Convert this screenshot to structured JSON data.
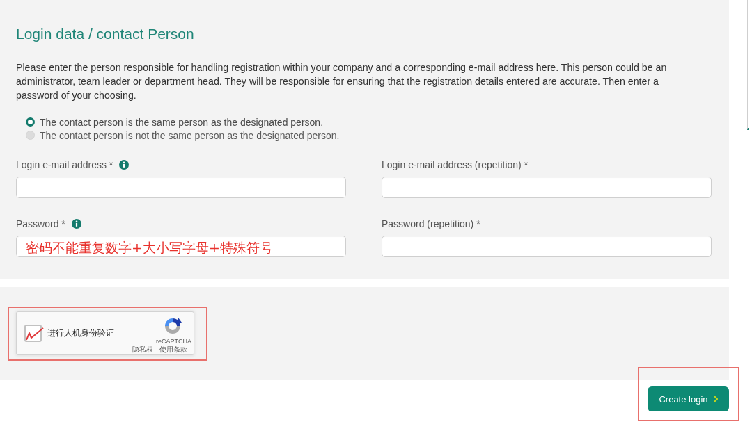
{
  "section": {
    "title": "Login data / contact Person",
    "description": "Please enter the person responsible for handling registration within your company and a corresponding e-mail address here. This person could be an administrator, team leader or department head. They will be responsible for ensuring that the registration details entered are accurate. Then enter a password of your choosing."
  },
  "contact_options": [
    {
      "label": "The contact person is the same person as the designated person.",
      "selected": true
    },
    {
      "label": "The contact person is not the same person as the designated person.",
      "selected": false
    }
  ],
  "fields": [
    {
      "label": "Login e-mail address *",
      "info": true
    },
    {
      "label": "Login e-mail address (repetition) *",
      "info": false
    },
    {
      "label": "Password *",
      "info": true,
      "value": "密码不能重复数字+大小写字母+特殊符号"
    },
    {
      "label": "Password (repetition) *",
      "info": false
    }
  ],
  "captcha": {
    "label": "进行人机身份验证",
    "brand": "reCAPTCHA",
    "links": "隐私权 - 使用条款",
    "checked": true,
    "highlighted": true
  },
  "submit_button": {
    "label": "Create login",
    "highlighted": true
  }
}
